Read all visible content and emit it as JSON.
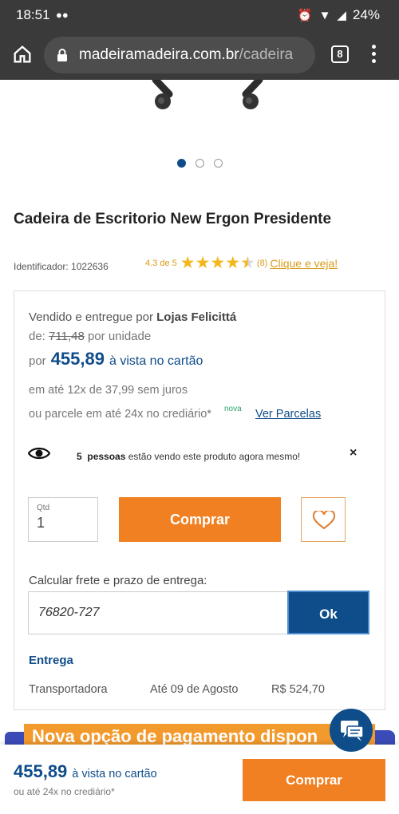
{
  "status_bar": {
    "time": "18:51",
    "battery": "24%"
  },
  "browser": {
    "url_domain": "madeiramadeira.com.br",
    "url_path": "/cadeira",
    "tab_count": "8"
  },
  "product": {
    "title": "Cadeira de Escritorio New Ergon Presidente",
    "identifier": "Identificador: 1022636",
    "rating_score": "4.3 de 5",
    "rating_count": "(8)",
    "rating_link": "Clique e veja!",
    "rating_value": 4.3,
    "carousel_dots": 3,
    "carousel_active": 1
  },
  "panel": {
    "sold_by_prefix": "Vendido e entregue por",
    "seller": "Lojas Felicittá",
    "old_price_prefix": "de:",
    "old_price": "711,48",
    "old_price_suffix": "por unidade",
    "price_prefix": "por",
    "price": "455,89",
    "price_suffix": "à vista no cartão",
    "installment": "em até 12x de 37,99 sem juros",
    "crediario": "ou parcele em até 24x no crediário*",
    "nova_badge": "nova",
    "ver_parcelas": "Ver Parcelas",
    "viewers_count": "5",
    "viewers_people": "pessoas",
    "viewers_text": "estão vendo este produto agora mesmo!",
    "close": "×",
    "qty_label": "Qtd",
    "qty_value": "1",
    "buy_label": "Comprar",
    "freight_label": "Calcular frete e prazo de entrega:",
    "cep_value": "76820-727",
    "ok_label": "Ok",
    "entrega_label": "Entrega",
    "shipping": {
      "method": "Transportadora",
      "date": "Até 09 de Agosto",
      "price": "R$ 524,70"
    }
  },
  "banner": {
    "text": "Nova opção de pagamento dispon"
  },
  "sticky": {
    "price": "455,89",
    "price_suffix": "à vista no cartão",
    "sub": "ou até 24x no crediário*",
    "buy_label": "Comprar"
  },
  "colors": {
    "brand_blue": "#0f4d8a",
    "brand_orange": "#f08021",
    "star": "#f3b71c"
  }
}
